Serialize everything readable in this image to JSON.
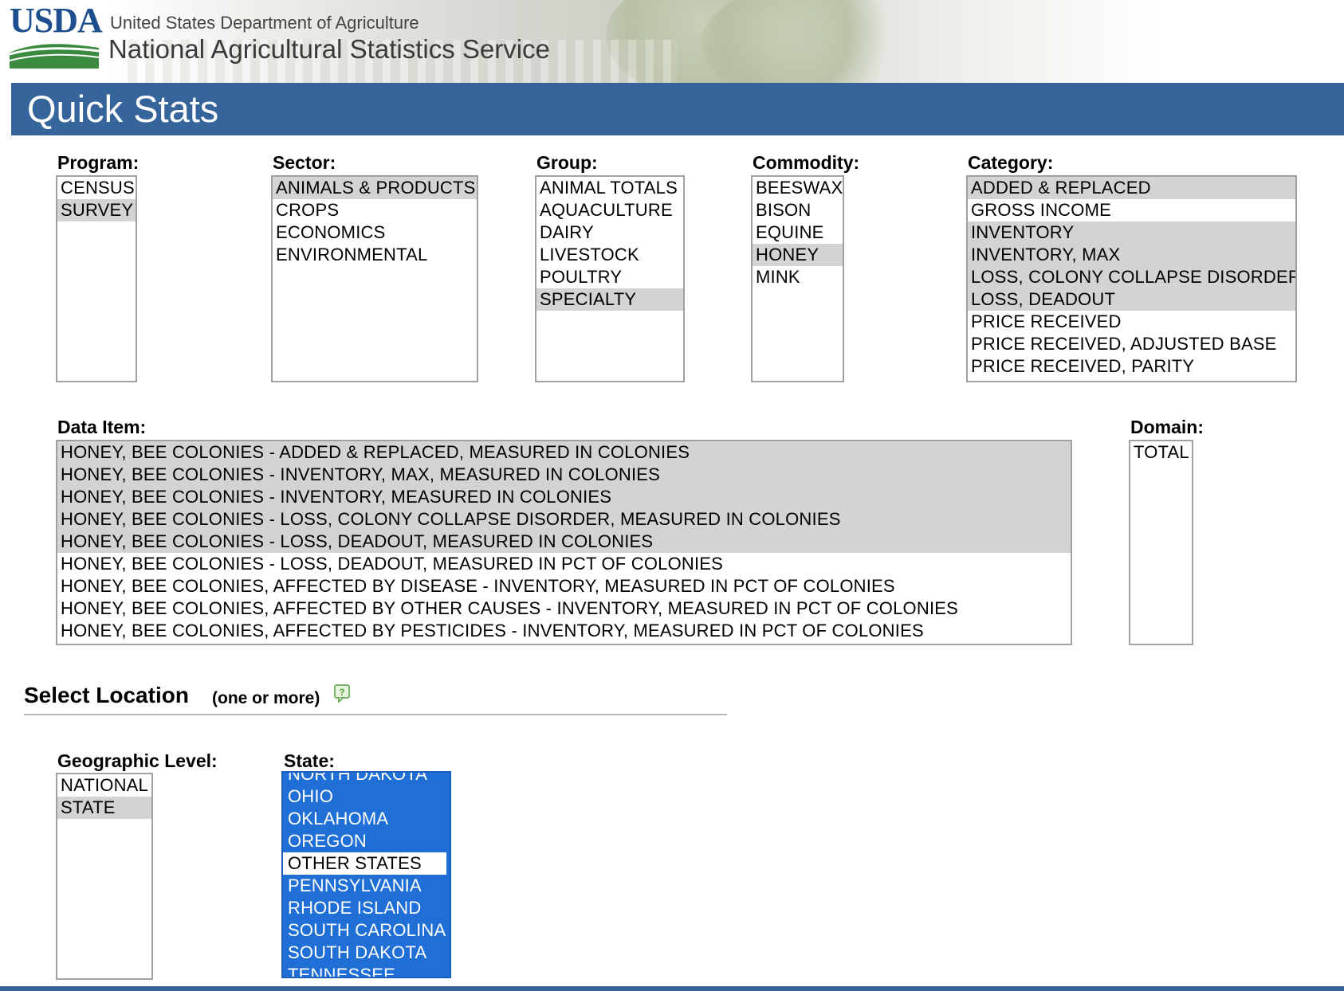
{
  "header": {
    "logo_text": "USDA",
    "department": "United States Department of Agriculture",
    "agency": "National Agricultural Statistics Service",
    "page_title": "Quick Stats"
  },
  "colors": {
    "title_bar": "#35659a",
    "selected_option": "#d3d3d3",
    "state_highlight": "#1f6fd6",
    "logo_blue": "#1f4e8f",
    "logo_green": "#3a8a3f"
  },
  "program": {
    "label": "Program:",
    "options": [
      {
        "text": "CENSUS",
        "selected": false
      },
      {
        "text": "SURVEY",
        "selected": true
      }
    ]
  },
  "sector": {
    "label": "Sector:",
    "options": [
      {
        "text": "ANIMALS & PRODUCTS",
        "selected": true
      },
      {
        "text": "CROPS",
        "selected": false
      },
      {
        "text": "ECONOMICS",
        "selected": false
      },
      {
        "text": "ENVIRONMENTAL",
        "selected": false
      }
    ]
  },
  "group": {
    "label": "Group:",
    "options": [
      {
        "text": "ANIMAL TOTALS",
        "selected": false
      },
      {
        "text": "AQUACULTURE",
        "selected": false
      },
      {
        "text": "DAIRY",
        "selected": false
      },
      {
        "text": "LIVESTOCK",
        "selected": false
      },
      {
        "text": "POULTRY",
        "selected": false
      },
      {
        "text": "SPECIALTY",
        "selected": true
      }
    ]
  },
  "commodity": {
    "label": "Commodity:",
    "options": [
      {
        "text": "BEESWAX",
        "selected": false
      },
      {
        "text": "BISON",
        "selected": false
      },
      {
        "text": "EQUINE",
        "selected": false
      },
      {
        "text": "HONEY",
        "selected": true
      },
      {
        "text": "MINK",
        "selected": false
      }
    ]
  },
  "category": {
    "label": "Category:",
    "options": [
      {
        "text": "ADDED & REPLACED",
        "selected": true
      },
      {
        "text": "GROSS INCOME",
        "selected": false
      },
      {
        "text": "INVENTORY",
        "selected": true
      },
      {
        "text": "INVENTORY, MAX",
        "selected": true
      },
      {
        "text": "LOSS, COLONY COLLAPSE DISORDER",
        "selected": true
      },
      {
        "text": "LOSS, DEADOUT",
        "selected": true
      },
      {
        "text": "PRICE RECEIVED",
        "selected": false
      },
      {
        "text": "PRICE RECEIVED, ADJUSTED BASE",
        "selected": false
      },
      {
        "text": "PRICE RECEIVED, PARITY",
        "selected": false
      }
    ]
  },
  "data_item": {
    "label": "Data Item:",
    "options": [
      {
        "text": "HONEY, BEE COLONIES - ADDED & REPLACED, MEASURED IN COLONIES",
        "selected": true
      },
      {
        "text": "HONEY, BEE COLONIES - INVENTORY, MAX, MEASURED IN COLONIES",
        "selected": true
      },
      {
        "text": "HONEY, BEE COLONIES - INVENTORY, MEASURED IN COLONIES",
        "selected": true
      },
      {
        "text": "HONEY, BEE COLONIES - LOSS, COLONY COLLAPSE DISORDER, MEASURED IN COLONIES",
        "selected": true
      },
      {
        "text": "HONEY, BEE COLONIES - LOSS, DEADOUT, MEASURED IN COLONIES",
        "selected": true
      },
      {
        "text": "HONEY, BEE COLONIES - LOSS, DEADOUT, MEASURED IN PCT OF COLONIES",
        "selected": false
      },
      {
        "text": "HONEY, BEE COLONIES, AFFECTED BY DISEASE - INVENTORY, MEASURED IN PCT OF COLONIES",
        "selected": false
      },
      {
        "text": "HONEY, BEE COLONIES, AFFECTED BY OTHER CAUSES - INVENTORY, MEASURED IN PCT OF COLONIES",
        "selected": false
      },
      {
        "text": "HONEY, BEE COLONIES, AFFECTED BY PESTICIDES - INVENTORY, MEASURED IN PCT OF COLONIES",
        "selected": false
      }
    ]
  },
  "domain": {
    "label": "Domain:",
    "options": [
      {
        "text": "TOTAL",
        "selected": false
      }
    ]
  },
  "location": {
    "title": "Select Location",
    "subtitle": "(one or more)",
    "help_icon": "help-bubble-icon"
  },
  "geo_level": {
    "label": "Geographic Level:",
    "options": [
      {
        "text": "NATIONAL",
        "selected": false
      },
      {
        "text": "STATE",
        "selected": true
      }
    ]
  },
  "state": {
    "label": "State:",
    "options": [
      {
        "text": "NORTH DAKOTA",
        "selected": true
      },
      {
        "text": "OHIO",
        "selected": true
      },
      {
        "text": "OKLAHOMA",
        "selected": true
      },
      {
        "text": "OREGON",
        "selected": true
      },
      {
        "text": "OTHER STATES",
        "selected": false
      },
      {
        "text": "PENNSYLVANIA",
        "selected": true
      },
      {
        "text": "RHODE ISLAND",
        "selected": true
      },
      {
        "text": "SOUTH CAROLINA",
        "selected": true
      },
      {
        "text": "SOUTH DAKOTA",
        "selected": true
      },
      {
        "text": "TENNESSEE",
        "selected": true
      }
    ]
  }
}
